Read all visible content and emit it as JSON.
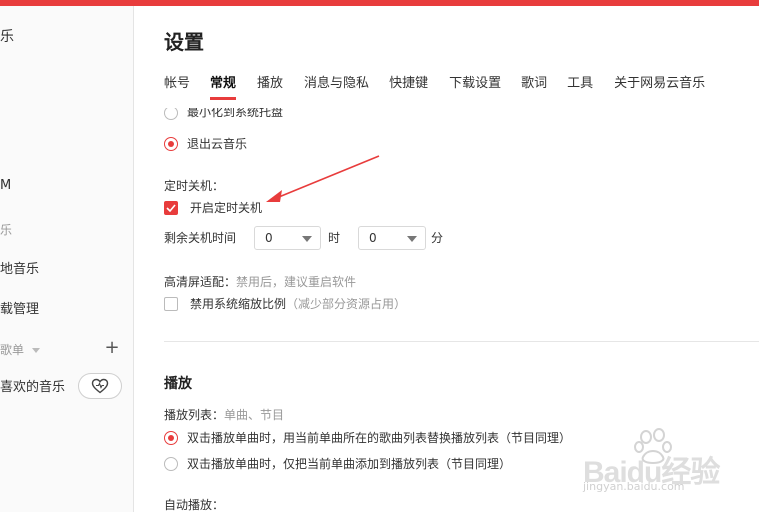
{
  "sidebar": {
    "partial_items": [
      {
        "text": "乐",
        "id": "sb-0"
      },
      {
        "text": "M",
        "id": "sb-1"
      },
      {
        "text": "乐",
        "id": "sb-2"
      },
      {
        "text": "地音乐",
        "id": "sb-3"
      },
      {
        "text": "载管理",
        "id": "sb-4"
      },
      {
        "text": "歌单",
        "id": "sb-5"
      },
      {
        "text": "喜欢的音乐",
        "id": "sb-6"
      }
    ],
    "plus_label": "+"
  },
  "main": {
    "title": "设置",
    "tabs": [
      {
        "label": "帐号",
        "active": false
      },
      {
        "label": "常规",
        "active": true
      },
      {
        "label": "播放",
        "active": false
      },
      {
        "label": "消息与隐私",
        "active": false
      },
      {
        "label": "快捷键",
        "active": false
      },
      {
        "label": "下载设置",
        "active": false
      },
      {
        "label": "歌词",
        "active": false
      },
      {
        "label": "工具",
        "active": false
      },
      {
        "label": "关于网易云音乐",
        "active": false
      }
    ],
    "close_options": {
      "partial_option": "最小化到系统托盘",
      "exit_option": "退出云音乐"
    },
    "timer": {
      "heading": "定时关机：",
      "checkbox_label": "开启定时关机",
      "remaining_label": "剩余关机时间",
      "hours_value": "0",
      "hours_unit": "时",
      "minutes_value": "0",
      "minutes_unit": "分"
    },
    "hidpi": {
      "heading": "高清屏适配：",
      "hint": "禁用后，建议重启软件",
      "checkbox_label": "禁用系统缩放比例",
      "checkbox_hint": "（减少部分资源占用）"
    },
    "playback": {
      "section_title": "播放",
      "playlist_heading": "播放列表：",
      "playlist_hint": "单曲、节目",
      "option_replace": "双击播放单曲时，用当前单曲所在的歌曲列表替换播放列表（节目同理）",
      "option_add": "双击播放单曲时，仅把当前单曲添加到播放列表（节目同理）",
      "autoplay_heading": "自动播放："
    }
  },
  "watermark": {
    "brand": "Baidu经验",
    "url": "jingyan.baidu.com"
  },
  "colors": {
    "accent": "#e83c3c",
    "arrow": "#e83c3c"
  }
}
